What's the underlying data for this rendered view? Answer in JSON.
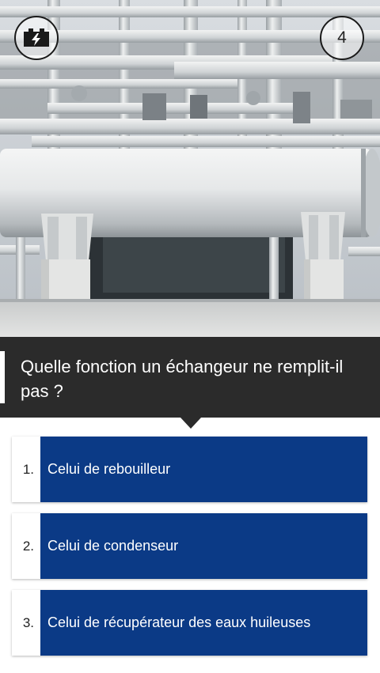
{
  "header": {
    "battery_icon": "battery-charging-icon",
    "question_number": "4"
  },
  "question": {
    "text": "Quelle fonction un échangeur ne remplit-il pas ?"
  },
  "answers": [
    {
      "number": "1.",
      "label": "Celui de rebouilleur"
    },
    {
      "number": "2.",
      "label": "Celui de condenseur"
    },
    {
      "number": "3.",
      "label": "Celui de récupérateur des eaux huileuses"
    }
  ],
  "colors": {
    "answer_bg": "#0b3a86",
    "question_bg": "#2b2b2b"
  }
}
